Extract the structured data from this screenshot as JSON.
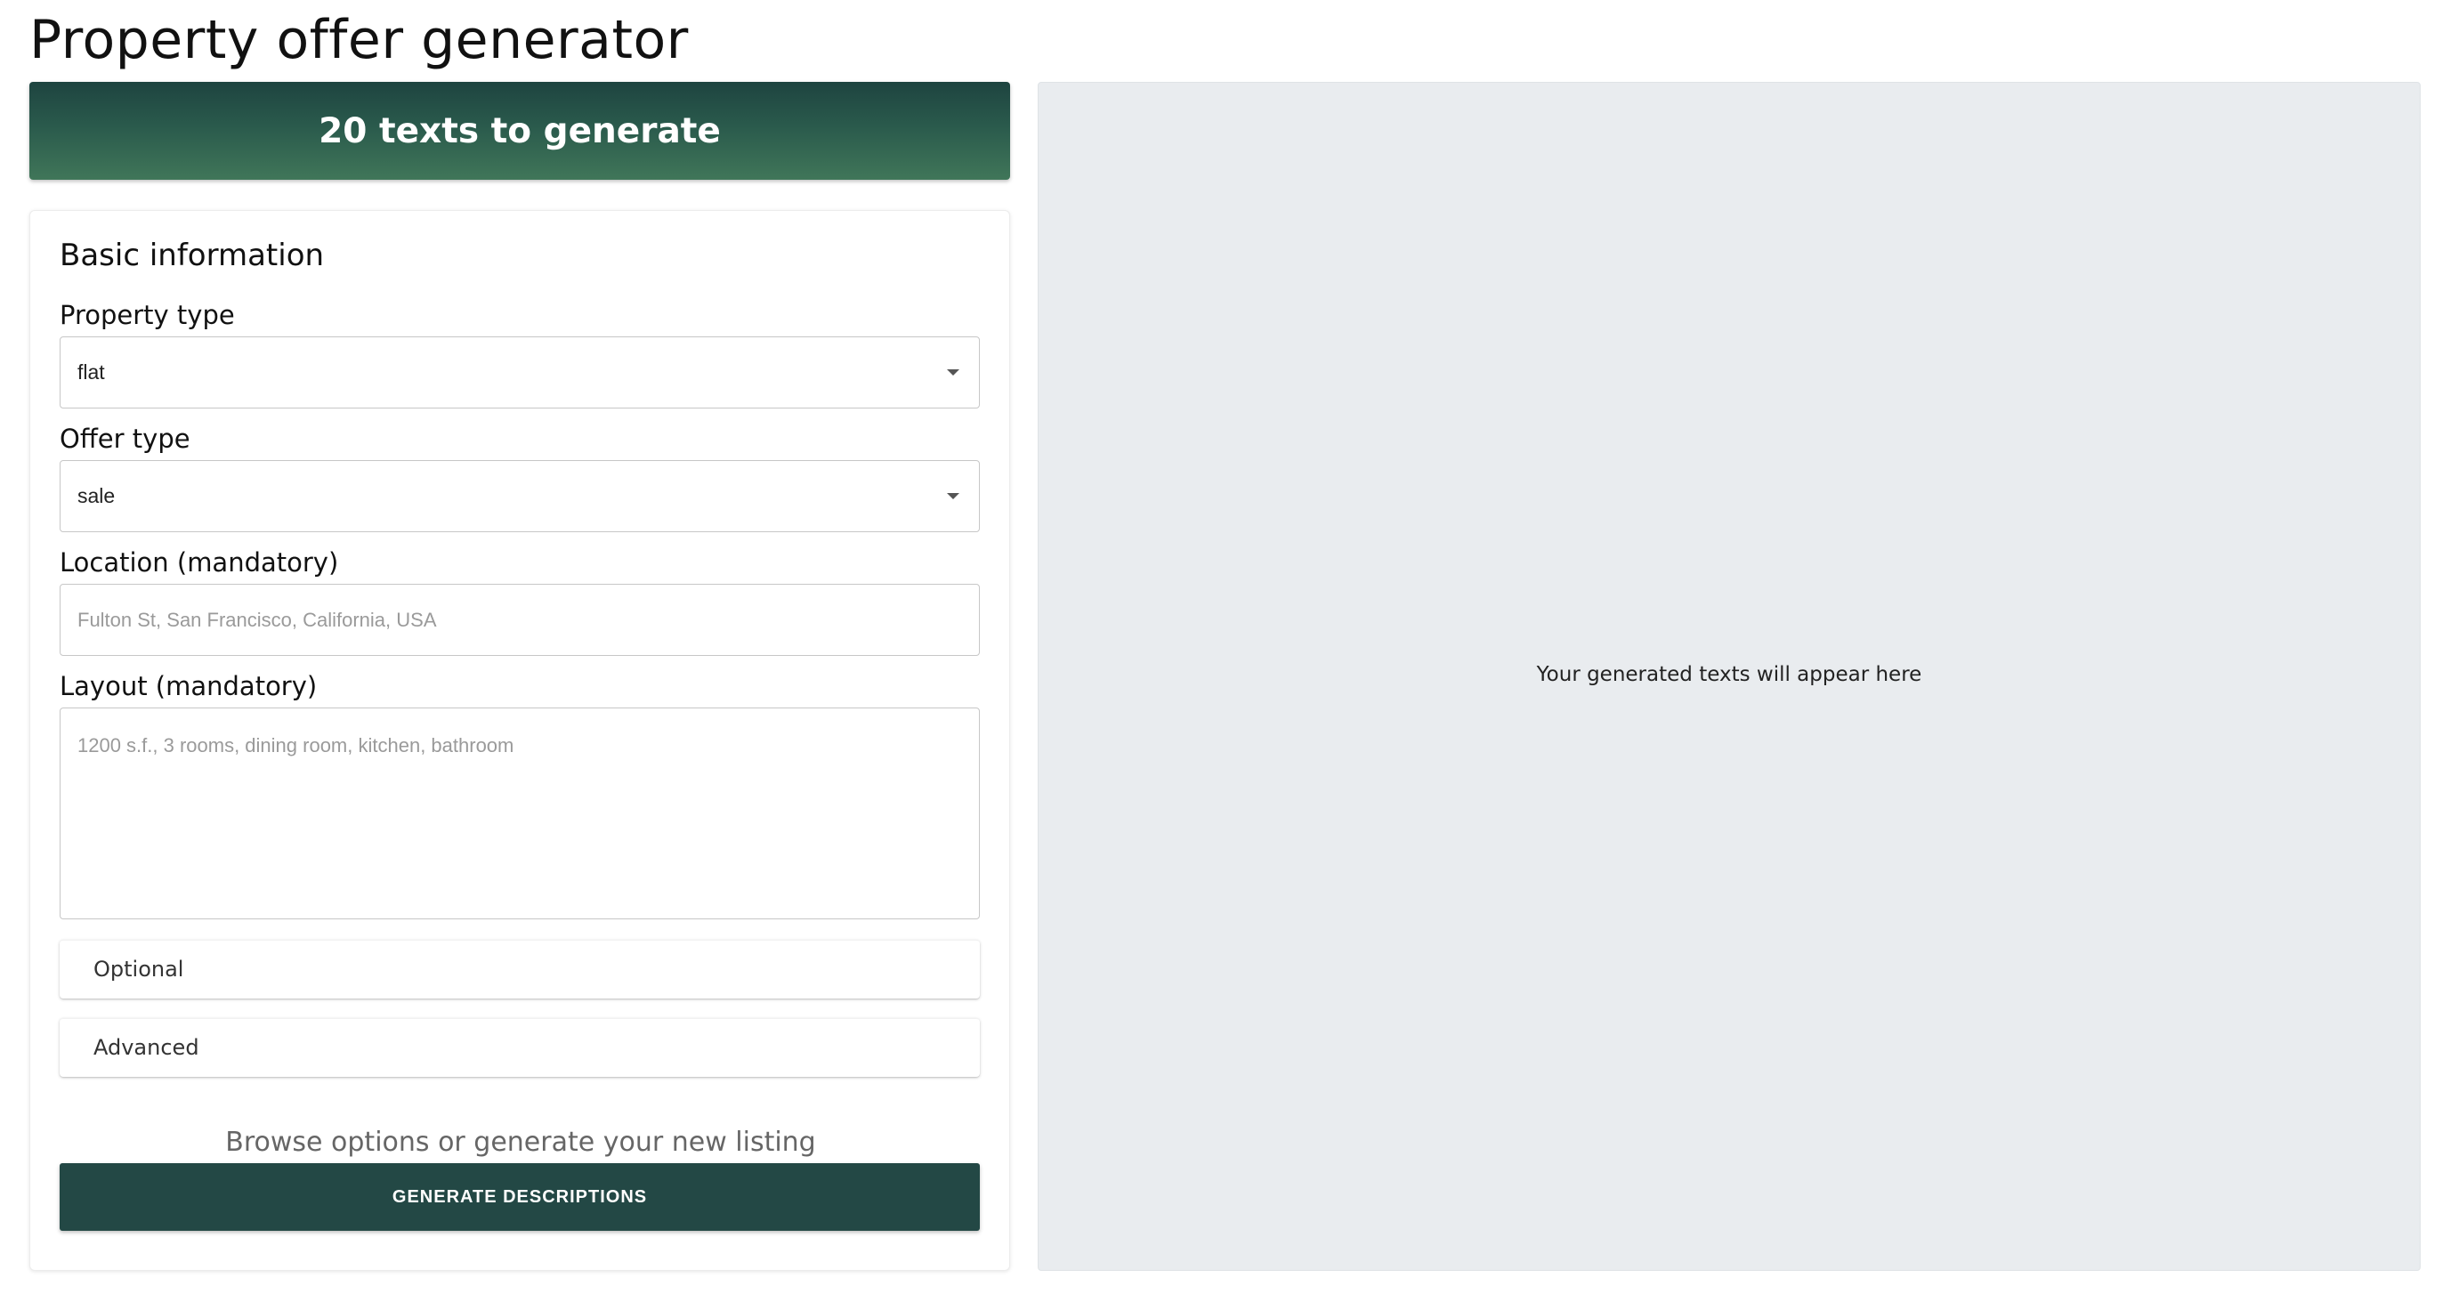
{
  "page": {
    "title": "Property offer generator"
  },
  "banner": {
    "text": "20 texts to generate"
  },
  "form": {
    "section_title": "Basic information",
    "property_type": {
      "label": "Property type",
      "value": "flat"
    },
    "offer_type": {
      "label": "Offer type",
      "value": "sale"
    },
    "location": {
      "label": "Location (mandatory)",
      "placeholder": "Fulton St, San Francisco, California, USA"
    },
    "layout": {
      "label": "Layout (mandatory)",
      "placeholder": "1200 s.f., 3 rooms, dining room, kitchen, bathroom"
    },
    "optional_section": {
      "label": "Optional"
    },
    "advanced_section": {
      "label": "Advanced"
    },
    "hint": "Browse options or generate your new listing",
    "generate_button": "GENERATE DESCRIPTIONS"
  },
  "output": {
    "placeholder": "Your generated texts will appear here"
  },
  "colors": {
    "banner_dark": "#1e4440",
    "banner_light": "#407659",
    "button": "#234845",
    "output_bg": "#e9ecef"
  }
}
